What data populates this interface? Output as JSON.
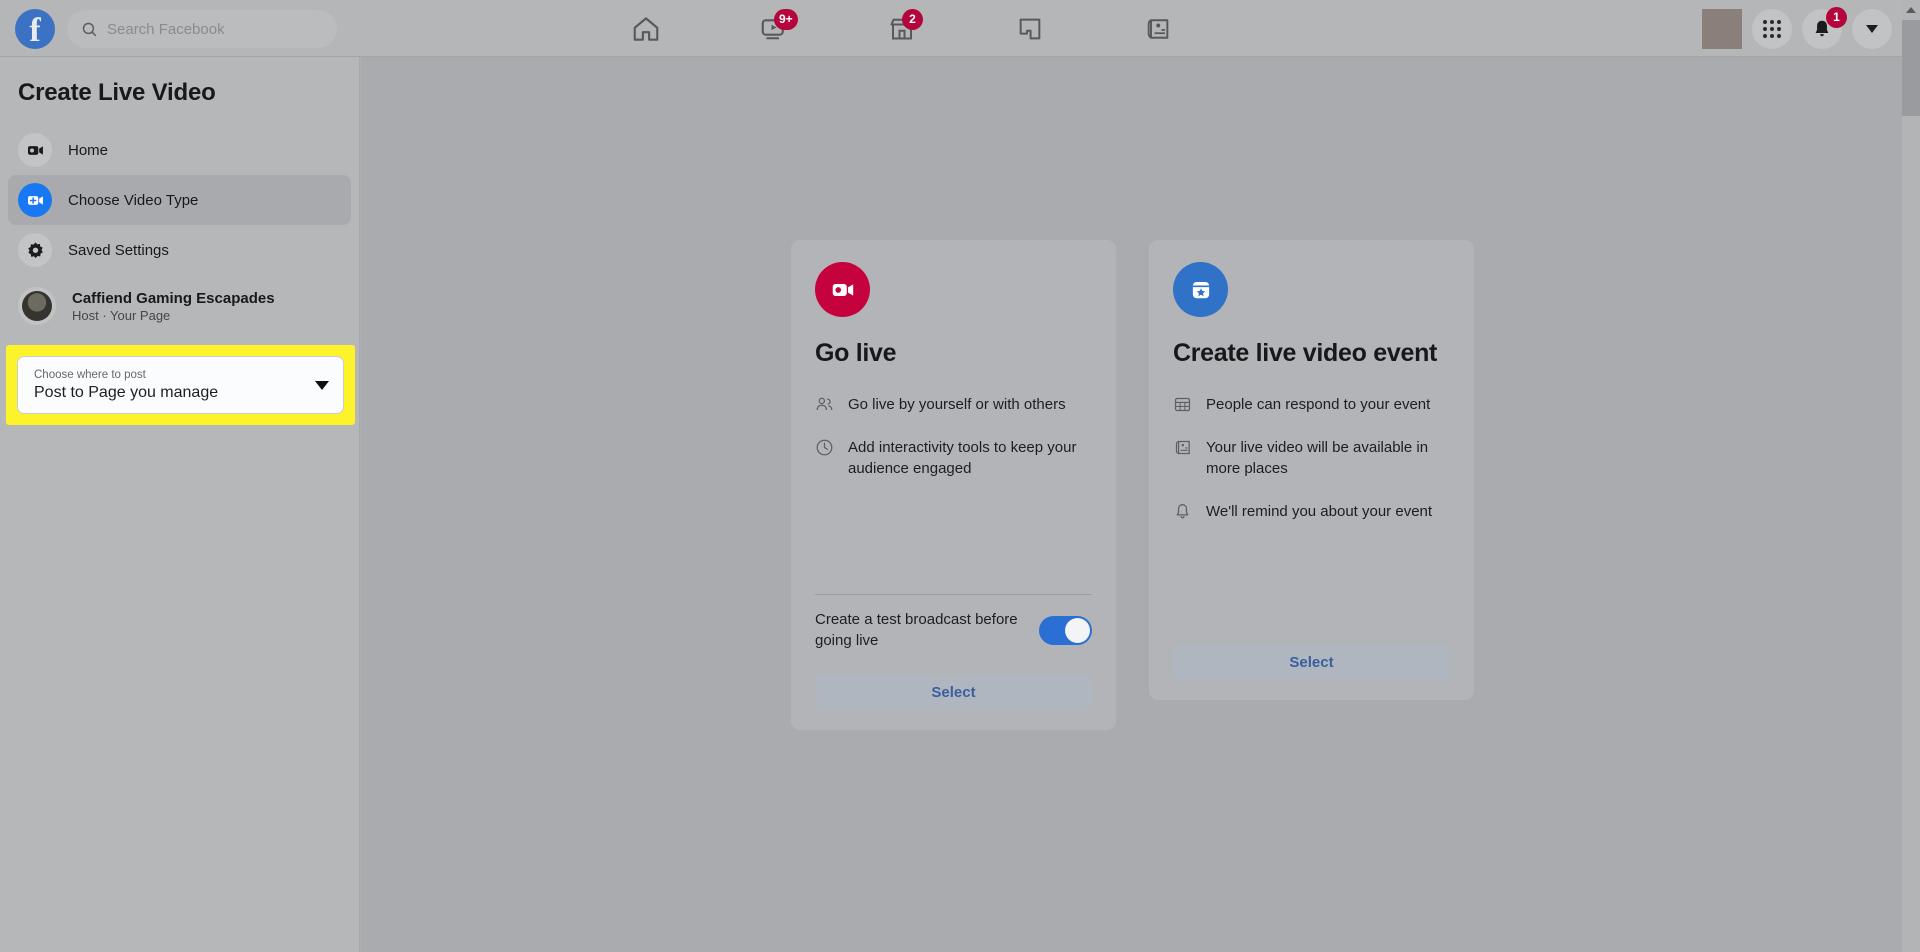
{
  "topbar": {
    "logo": "facebook-logo",
    "search": {
      "placeholder": "Search Facebook",
      "value": "",
      "icon": "search-icon"
    },
    "nav": [
      {
        "name": "home",
        "icon": "home-icon",
        "badge": ""
      },
      {
        "name": "video",
        "icon": "video-icon",
        "badge": "9+"
      },
      {
        "name": "marketplace",
        "icon": "marketplace-icon",
        "badge": "2"
      },
      {
        "name": "gaming",
        "icon": "gaming-icon",
        "badge": ""
      },
      {
        "name": "news",
        "icon": "news-feed-icon",
        "badge": ""
      }
    ],
    "right": {
      "menu_icon": "grid-menu-icon",
      "notifications_icon": "bell-icon",
      "notifications_badge": "1",
      "account_icon": "chevron-down-icon"
    }
  },
  "sidebar": {
    "title": "Create Live Video",
    "items": [
      {
        "label": "Home",
        "icon": "video-camera-icon",
        "selected": false
      },
      {
        "label": "Choose Video Type",
        "icon": "add-video-icon",
        "selected": true
      },
      {
        "label": "Saved Settings",
        "icon": "gear-icon",
        "selected": false
      }
    ],
    "page": {
      "name": "Caffiend Gaming Escapades",
      "role": "Host · Your Page",
      "avatar": "page-avatar"
    },
    "post_target": {
      "label": "Choose where to post",
      "value": "Post to Page you manage",
      "caret": "chevron-down-icon",
      "highlight_color": "#fdf32a"
    }
  },
  "main": {
    "cards": [
      {
        "id": "go-live",
        "icon": "live-video-icon",
        "icon_color": "#c5023e",
        "heading": "Go live",
        "bullets": [
          {
            "icon": "people-icon",
            "text": "Go live by yourself or with others"
          },
          {
            "icon": "clock-icon",
            "text": "Add interactivity tools to keep your audience engaged"
          }
        ],
        "toggle": {
          "label": "Create a test broadcast before going live",
          "on": true
        },
        "button": "Select"
      },
      {
        "id": "create-live-video-event",
        "icon": "event-star-icon",
        "icon_color": "#2f72c7",
        "heading": "Create live video event",
        "bullets": [
          {
            "icon": "calendar-grid-icon",
            "text": "People can respond to your event"
          },
          {
            "icon": "feed-icon",
            "text": "Your live video will be available in more places"
          },
          {
            "icon": "bell-icon",
            "text": "We'll remind you about your event"
          }
        ],
        "button": "Select"
      }
    ]
  }
}
